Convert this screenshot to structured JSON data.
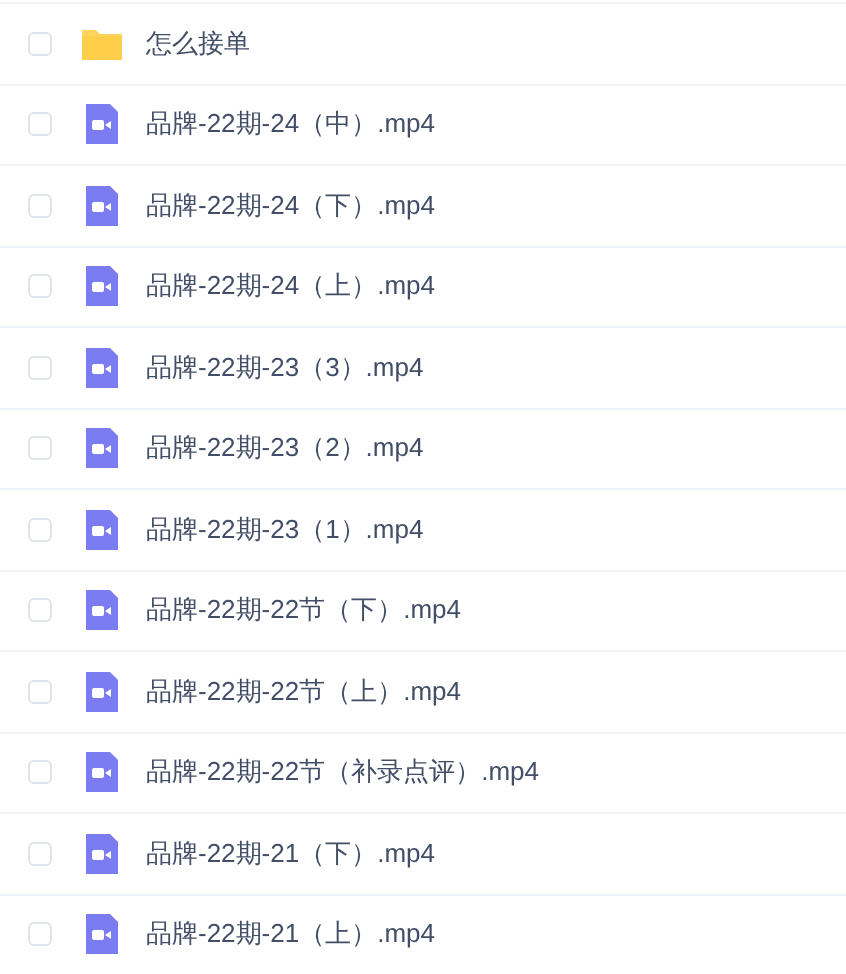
{
  "files": [
    {
      "kind": "folder",
      "name": "怎么接单",
      "checked": false
    },
    {
      "kind": "video",
      "name": "品牌-22期-24（中）.mp4",
      "checked": false
    },
    {
      "kind": "video",
      "name": "品牌-22期-24（下）.mp4",
      "checked": false
    },
    {
      "kind": "video",
      "name": "品牌-22期-24（上）.mp4",
      "checked": false
    },
    {
      "kind": "video",
      "name": "品牌-22期-23（3）.mp4",
      "checked": false
    },
    {
      "kind": "video",
      "name": "品牌-22期-23（2）.mp4",
      "checked": false
    },
    {
      "kind": "video",
      "name": "品牌-22期-23（1）.mp4",
      "checked": false
    },
    {
      "kind": "video",
      "name": "品牌-22期-22节（下）.mp4",
      "checked": false
    },
    {
      "kind": "video",
      "name": "品牌-22期-22节（上）.mp4",
      "checked": false
    },
    {
      "kind": "video",
      "name": "品牌-22期-22节（补录点评）.mp4",
      "checked": false
    },
    {
      "kind": "video",
      "name": "品牌-22期-21（下）.mp4",
      "checked": false
    },
    {
      "kind": "video",
      "name": "品牌-22期-21（上）.mp4",
      "checked": false
    }
  ]
}
